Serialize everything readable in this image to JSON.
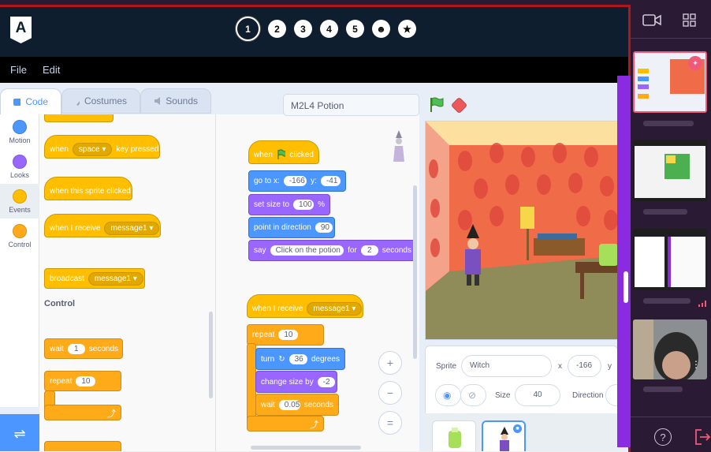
{
  "topbar": {
    "logo_letter": "A",
    "steps": [
      "1",
      "2",
      "3",
      "4",
      "5",
      "☻",
      "★"
    ]
  },
  "menu": {
    "file": "File",
    "edit": "Edit"
  },
  "tabs": {
    "code": "Code",
    "costumes": "Costumes",
    "sounds": "Sounds"
  },
  "categories": [
    {
      "label": "Motion",
      "color": "#4c97ff"
    },
    {
      "label": "Looks",
      "color": "#9966ff"
    },
    {
      "label": "Events",
      "color": "#ffbf00"
    },
    {
      "label": "Control",
      "color": "#ffab19"
    }
  ],
  "palette": {
    "when_key": "when",
    "key_value": "space ▾",
    "key_pressed": "key pressed",
    "sprite_clicked": "when this sprite clicked",
    "when_receive": "when I receive",
    "message1": "message1 ▾",
    "broadcast": "broadcast",
    "broadcast_msg": "message1 ▾",
    "control_label": "Control",
    "wait": "wait",
    "wait_val": "1",
    "seconds": "seconds",
    "repeat": "repeat",
    "repeat_val": "10"
  },
  "script1": {
    "when": "when",
    "clicked": "clicked",
    "goto": "go to x:",
    "x": "-166",
    "y_label": "y:",
    "y": "-41",
    "setsize": "set size to",
    "size": "100",
    "pct": "%",
    "point": "point in direction",
    "dir": "90",
    "say": "say",
    "say_text": "Click on the potion",
    "for": "for",
    "say_secs": "2",
    "seconds": "seconds"
  },
  "script2": {
    "when_receive": "when I receive",
    "msg": "message1 ▾",
    "repeat": "repeat",
    "repeat_val": "10",
    "turn": "turn",
    "turn_val": "36",
    "degrees": "degrees",
    "change_size": "change size by",
    "change_val": "-2",
    "wait": "wait",
    "wait_val": "0.05",
    "seconds": "seconds"
  },
  "project": {
    "title": "M2L4 Potion"
  },
  "sprite_info": {
    "sprite_label": "Sprite",
    "sprite_name": "Witch",
    "x_label": "x",
    "x_val": "-166",
    "y_label": "y",
    "size_label": "Size",
    "size_val": "40",
    "direction_label": "Direction"
  },
  "zoom": {
    "in": "+",
    "out": "−",
    "reset": "="
  }
}
